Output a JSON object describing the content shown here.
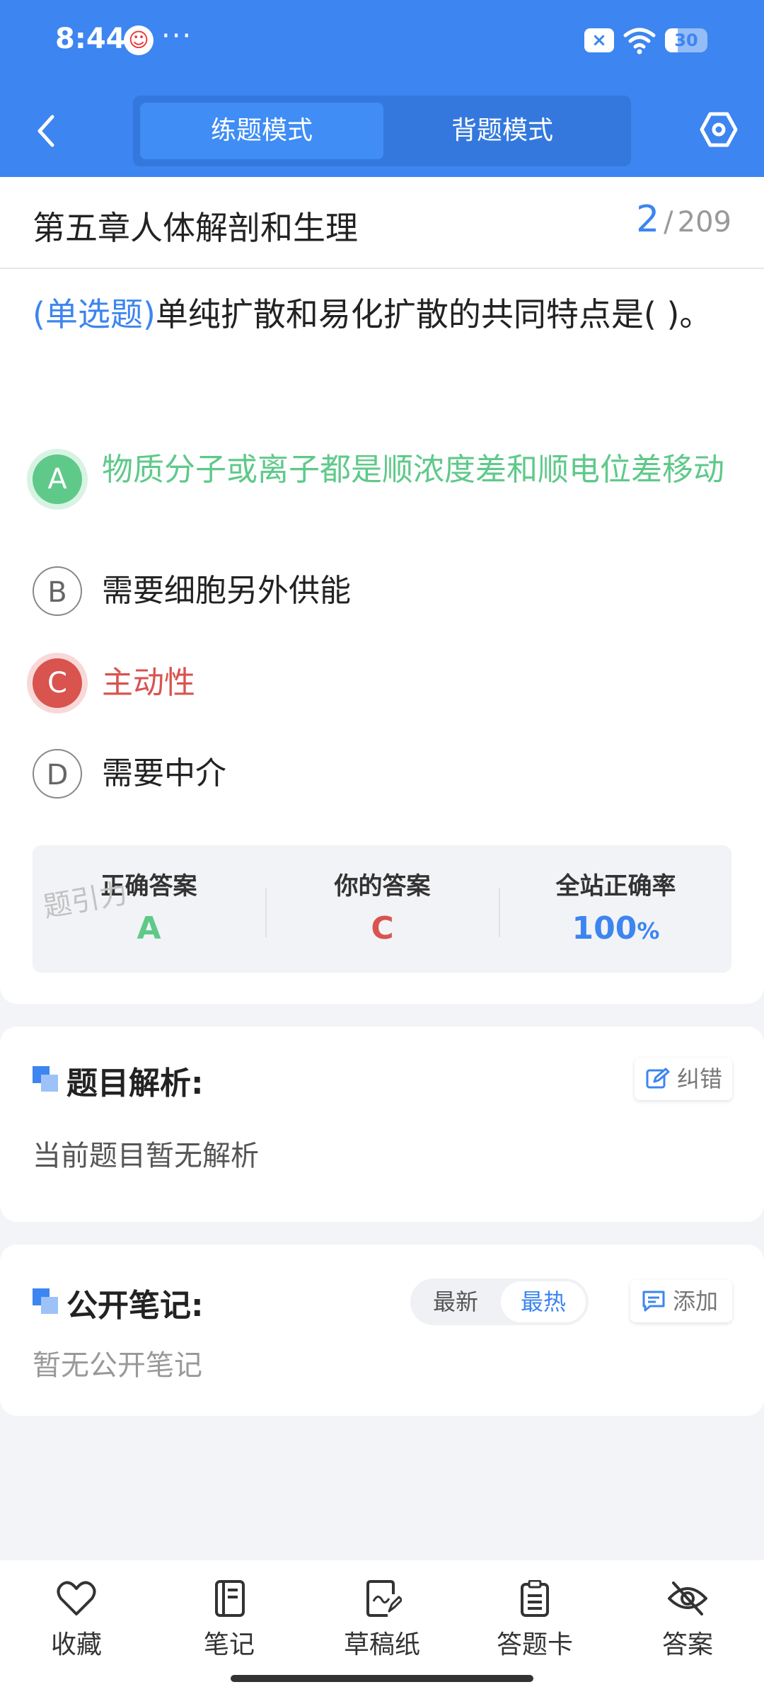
{
  "status_bar": {
    "time": "8:44",
    "more": "···",
    "battery_level": "30",
    "battery_fraction": 0.3
  },
  "header": {
    "tabs": [
      {
        "label": "练题模式",
        "active": true
      },
      {
        "label": "背题模式",
        "active": false
      }
    ]
  },
  "question": {
    "chapter": "第五章人体解剖和生理",
    "current": "2",
    "separator": "/",
    "total": "209",
    "type_label": "(单选题)",
    "stem": "单纯扩散和易化扩散的共同特点是(    )。",
    "options": [
      {
        "letter": "A",
        "text": "物质分子或离子都是顺浓度差和顺电位差移动",
        "state": "correct"
      },
      {
        "letter": "B",
        "text": "需要细胞另外供能",
        "state": "plain"
      },
      {
        "letter": "C",
        "text": "主动性",
        "state": "wrong"
      },
      {
        "letter": "D",
        "text": "需要中介",
        "state": "plain"
      }
    ]
  },
  "result": {
    "correct_label": "正确答案",
    "correct_value": "A",
    "yours_label": "你的答案",
    "yours_value": "C",
    "rate_label": "全站正确率",
    "rate_value": "100",
    "rate_unit": "%",
    "watermark": "题引力"
  },
  "analysis": {
    "title": "题目解析:",
    "report_label": "纠错",
    "body": "当前题目暂无解析"
  },
  "notes": {
    "title": "公开笔记:",
    "sort_latest": "最新",
    "sort_hot": "最热",
    "add_label": "添加",
    "empty": "暂无公开笔记"
  },
  "bottom_nav": {
    "items": [
      {
        "label": "收藏",
        "icon": "heart-icon"
      },
      {
        "label": "笔记",
        "icon": "notebook-icon"
      },
      {
        "label": "草稿纸",
        "icon": "draft-icon"
      },
      {
        "label": "答题卡",
        "icon": "clipboard-icon"
      },
      {
        "label": "答案",
        "icon": "eye-off-icon"
      }
    ]
  },
  "colors": {
    "primary": "#3d85f0",
    "correct": "#5fc98a",
    "wrong": "#d9534f"
  }
}
